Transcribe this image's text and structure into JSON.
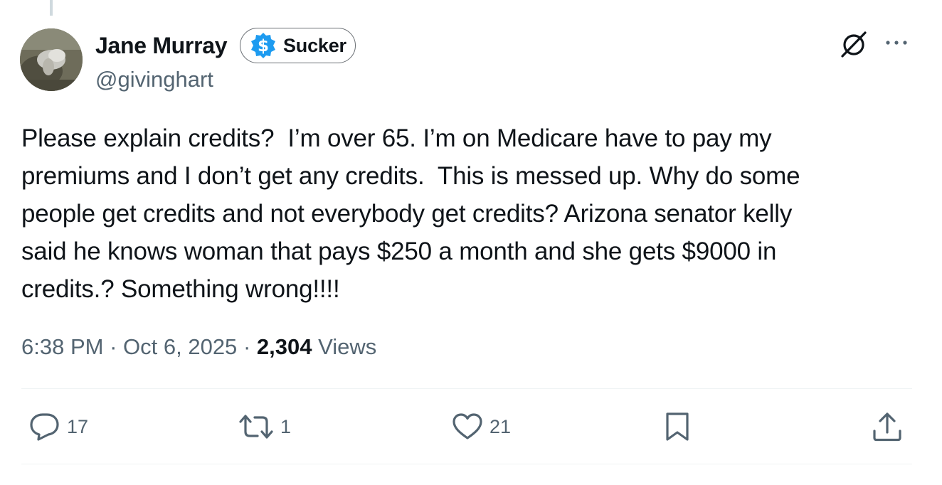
{
  "author": {
    "display_name": "Jane Murray",
    "handle": "@givinghart",
    "badge": {
      "label": "Sucker",
      "icon": "dollar-circle-icon",
      "icon_color": "#1d9bf0"
    }
  },
  "tweet": {
    "text": "Please explain credits?  I’m over 65. I’m on Medicare have to pay my\npremiums and I don’t get any credits.  This is messed up. Why do some\npeople get credits and not everybody get credits? Arizona senator kelly\nsaid he knows woman that pays $250 a month and she gets $9000 in\ncredits.? Something wrong!!!!",
    "time": "6:38 PM",
    "separator": "·",
    "date": "Oct 6, 2025",
    "views_count": "2,304",
    "views_label": "Views"
  },
  "header_icons": {
    "grok": "grok-icon",
    "more": "more-icon"
  },
  "actions": {
    "reply": {
      "icon": "reply-icon",
      "count": "17"
    },
    "repost": {
      "icon": "repost-icon",
      "count": "1"
    },
    "like": {
      "icon": "heart-icon",
      "count": "21"
    },
    "bookmark": {
      "icon": "bookmark-icon"
    },
    "share": {
      "icon": "share-icon"
    }
  },
  "colors": {
    "text": "#0f1419",
    "secondary": "#536471",
    "accent": "#1d9bf0",
    "divider": "#eff3f4"
  }
}
